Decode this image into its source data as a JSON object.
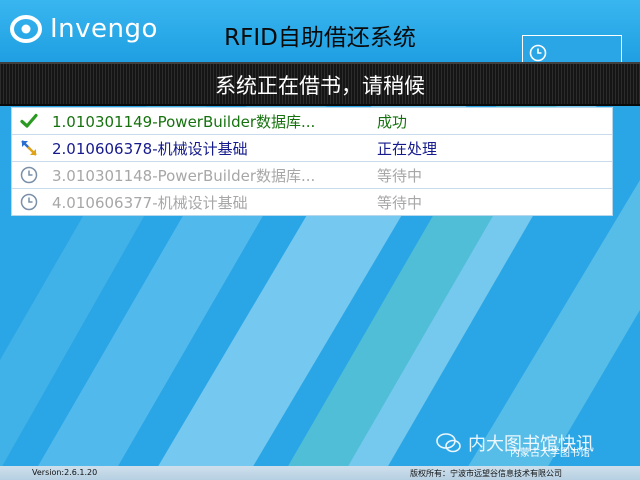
{
  "header": {
    "brand": "Invengo",
    "title": "RFID自助借还系统"
  },
  "status_band": {
    "text": "系统正在借书，请稍候"
  },
  "tasks": [
    {
      "title": "1.010301149-PowerBuilder数据库...",
      "status": "成功",
      "state": "success",
      "icon": "check-icon"
    },
    {
      "title": "2.010606378-机械设计基础",
      "status": "正在处理",
      "state": "processing",
      "icon": "processing-arrows-icon"
    },
    {
      "title": "3.010301148-PowerBuilder数据库...",
      "status": "等待中",
      "state": "waiting",
      "icon": "clock-icon"
    },
    {
      "title": "4.010606377-机械设计基础",
      "status": "等待中",
      "state": "waiting",
      "icon": "clock-icon"
    }
  ],
  "footer": {
    "version": "Version:2.6.1.20",
    "copyright": "版权所有：宁波市远望谷信息技术有限公司"
  },
  "watermark": {
    "text": "内大图书馆快讯",
    "subtext": "內蒙古大学图书馆"
  },
  "colors": {
    "background": "#2aa6e6",
    "success": "#16720f",
    "processing": "#151a8c",
    "waiting": "#a7a7a7"
  }
}
